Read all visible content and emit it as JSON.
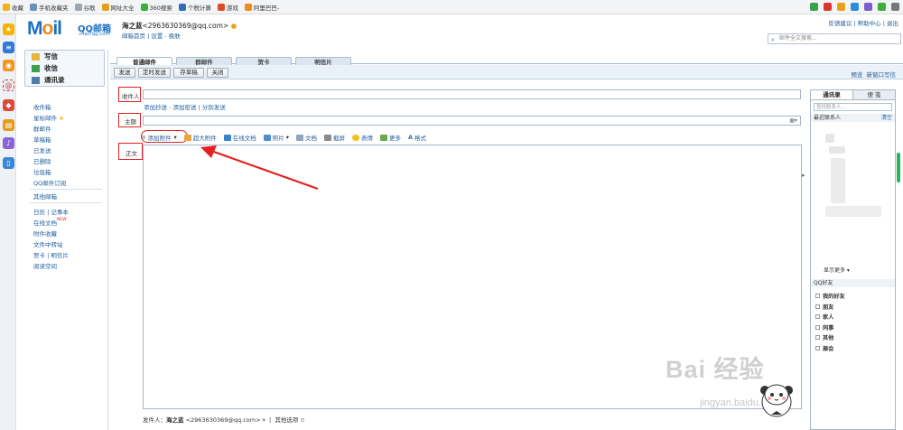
{
  "bookmarks": [
    {
      "label": "收藏",
      "color": "#f2b01e"
    },
    {
      "label": "手机收藏夹",
      "color": "#6b8fb8"
    },
    {
      "label": "谷歌",
      "color": "#9aa6b2"
    },
    {
      "label": "网址大全",
      "color": "#e3a21a"
    },
    {
      "label": "360搜索",
      "color": "#3cae3a"
    },
    {
      "label": "个税计算",
      "color": "#2f6fb5"
    },
    {
      "label": "游戏",
      "color": "#e24b2a"
    },
    {
      "label": "阿里巴巴-",
      "color": "#f08a1d"
    }
  ],
  "header": {
    "logo_main": "M",
    "logo_o": "o",
    "logo_rest": "il",
    "logo_cn": "QQ邮箱",
    "logo_domain": "mail.qq.com",
    "user_name": "海之蓝",
    "user_email": "<2963630369@qq.com>",
    "user_links": "邮箱首页 | 设置 - 换肤",
    "top_links": "反馈建议 | 帮助中心 | 退出",
    "search_placeholder": "邮件全文搜索..."
  },
  "nav": {
    "write": "写信",
    "inbox": "收信",
    "contacts": "通讯录",
    "folders": [
      "收件箱",
      "星标邮件",
      "群邮件",
      "草稿箱",
      "已发送",
      "已删除",
      "垃圾箱",
      "QQ邮件订阅"
    ],
    "other": "其他邮箱",
    "tools": [
      "日历 | 记事本",
      "在线文档",
      "附件收藏",
      "文件中转站",
      "贺卡 | 明信片",
      "阅读空间"
    ],
    "new_badge": "NEW"
  },
  "tabs": [
    "普通邮件",
    "群邮件",
    "贺卡",
    "明信片"
  ],
  "toolbar": {
    "send": "发送",
    "timed_send": "定时发送",
    "save_draft": "存草稿",
    "close": "关闭",
    "preview": "预览",
    "new_window": "新窗口写信"
  },
  "compose": {
    "to_label": "收件人",
    "to_links": "添加抄送 - 添加密送 | 分别发送",
    "subject_label": "主题",
    "body_label": "正文",
    "footer_sender": "发件人：",
    "footer_name": "海之蓝",
    "footer_email": "<2963630369@qq.com>",
    "footer_more": "其他选项"
  },
  "editor_tools": [
    "添加附件",
    "超大附件",
    "在线文档",
    "照片",
    "文档",
    "截屏",
    "表情",
    "更多",
    "格式"
  ],
  "contacts_panel": {
    "tab_contacts": "通讯录",
    "tab_notes": "便 笺",
    "search_placeholder": "查找联系人...",
    "recent": "最近联系人",
    "clear": "清空",
    "show_more": "显示更多",
    "qq_friends": "QQ好友",
    "groups": [
      "我的好友",
      "朋友",
      "家人",
      "同事",
      "其他",
      "展会"
    ]
  },
  "watermark": {
    "text": "Bai  经验",
    "url": "jingyan.baidu.com"
  },
  "colors": {
    "accent": "#1a6fc4",
    "annotation_red": "#e02222"
  }
}
